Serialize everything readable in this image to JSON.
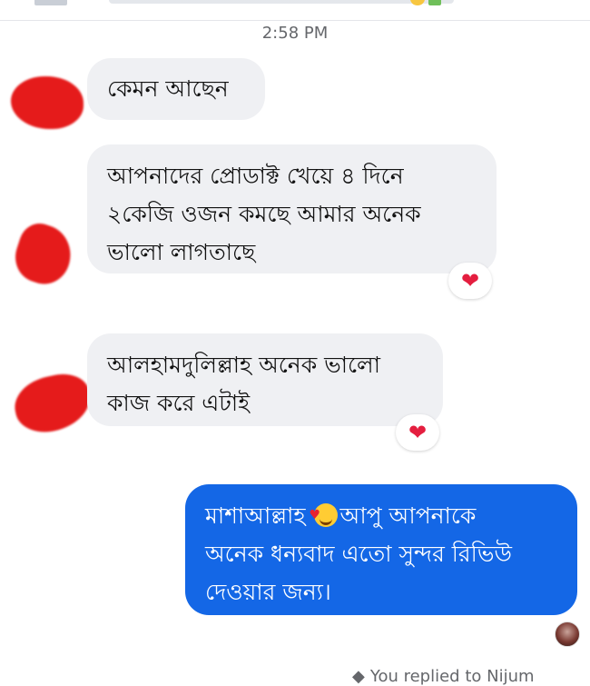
{
  "header": {
    "timestamp": "2:58 PM"
  },
  "messages": [
    {
      "sender": "contact",
      "text": "কেমন আছেন"
    },
    {
      "sender": "contact",
      "lines": [
        "আপনাদের প্রোডাক্ট খেয়ে ৪ দিনে",
        "২কেজি ওজন কমছে আমার অনেক",
        "ভালো লাগতাছে"
      ],
      "reaction": "heart-icon"
    },
    {
      "sender": "contact",
      "lines": [
        "আলহামদুলিল্লাহ অনেক ভালো",
        "কাজ করে এটাই"
      ],
      "reaction": "heart-icon"
    },
    {
      "sender": "me",
      "line1_before": "মাশাআল্লাহ",
      "line1_after": "আপু আপনাকে",
      "emoji": "smiling-face-with-hearts-icon",
      "lines": [
        "অনেক ধন্যবাদ এতো সুন্দর রিভিউ",
        "দেওয়ার জন্য।"
      ]
    }
  ],
  "footer": {
    "reply_text": "You replied to Nijum"
  },
  "colors": {
    "incoming_bubble": "#eff0f3",
    "outgoing_bubble": "#1467e6",
    "reaction_heart": "#e41e3f",
    "avatar_redaction": "#e51b1b"
  }
}
